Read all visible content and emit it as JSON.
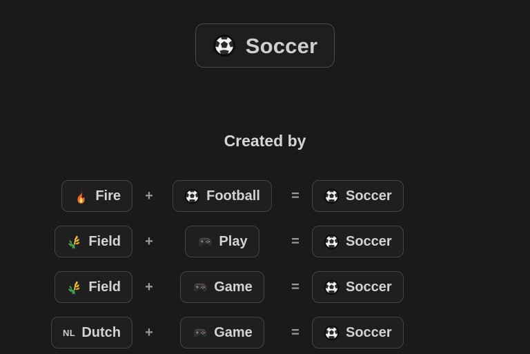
{
  "page": {
    "background": "#1a1a1a",
    "text_color": "#d4d4d4"
  },
  "header": {
    "title": "Soccer",
    "icon": "soccer-ball-icon"
  },
  "section": {
    "heading": "Created by"
  },
  "operators": {
    "plus": "+",
    "equals": "="
  },
  "recipes": [
    {
      "input_a": {
        "label": "Fire",
        "icon": "fire-icon"
      },
      "operator": "+",
      "input_b": {
        "label": "Football",
        "icon": "soccer-ball-icon"
      },
      "equals": "=",
      "result": {
        "label": "Soccer",
        "icon": "soccer-ball-icon"
      }
    },
    {
      "input_a": {
        "label": "Field",
        "icon": "sheaf-of-rice-icon"
      },
      "operator": "+",
      "input_b": {
        "label": "Play",
        "icon": "game-controller-icon"
      },
      "equals": "=",
      "result": {
        "label": "Soccer",
        "icon": "soccer-ball-icon"
      }
    },
    {
      "input_a": {
        "label": "Field",
        "icon": "sheaf-of-rice-icon"
      },
      "operator": "+",
      "input_b": {
        "label": "Game",
        "icon": "game-controller-icon"
      },
      "equals": "=",
      "result": {
        "label": "Soccer",
        "icon": "soccer-ball-icon"
      }
    },
    {
      "input_a": {
        "label": "Dutch",
        "icon": "flag-nl-badge",
        "badge_text": "NL"
      },
      "operator": "+",
      "input_b": {
        "label": "Game",
        "icon": "game-controller-icon"
      },
      "equals": "=",
      "result": {
        "label": "Soccer",
        "icon": "soccer-ball-icon"
      }
    }
  ]
}
